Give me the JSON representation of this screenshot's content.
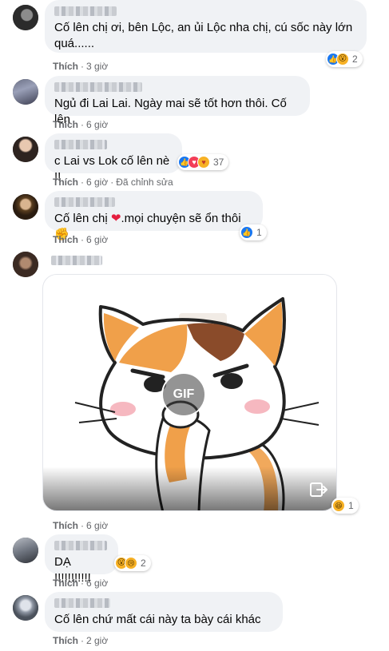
{
  "comments": [
    {
      "text": "Cố lên chị ơi, bên Lộc, an ủi Lộc nha chị, cú sốc này lớn quá......",
      "like_label": "Thích",
      "time": "3 giờ",
      "reaction_count": "2"
    },
    {
      "text": "Ngủ đi Lai Lai. Ngày mai sẽ tốt hơn thôi. Cố lên",
      "like_label": "Thích",
      "time": "6 giờ"
    },
    {
      "text": "c Lai vs Lok cố lên nè !!",
      "like_label": "Thích",
      "time": "6 giờ",
      "edited": "Đã chỉnh sửa",
      "reaction_count": "37"
    },
    {
      "text_before": "Cố lên chị",
      "text_after": ".mọi chuyện sẽ ổn thôi",
      "like_label": "Thích",
      "time": "6 giờ",
      "reaction_count": "1"
    },
    {
      "gif_label": "GIF",
      "like_label": "Thích",
      "time": "6 giờ",
      "reaction_count": "1"
    },
    {
      "text": "DẠ !!!!!!!!!!!",
      "like_label": "Thích",
      "time": "6 giờ",
      "reaction_count": "2"
    },
    {
      "text": "Cố lên chứ mất cái này ta bày cái khác",
      "like_label": "Thích",
      "time": "2 giờ"
    }
  ],
  "icons": {
    "like": "like-reaction-icon",
    "love": "love-reaction-icon",
    "wow": "wow-reaction-icon",
    "care": "care-reaction-icon",
    "heart_emoji": "red-heart-emoji",
    "share": "share-icon"
  },
  "colors": {
    "bubble": "#f0f2f5",
    "meta": "#65676b",
    "like_blue": "#1877f2",
    "love_red": "#f33e58",
    "emoji_yellow": "#f7b125"
  }
}
